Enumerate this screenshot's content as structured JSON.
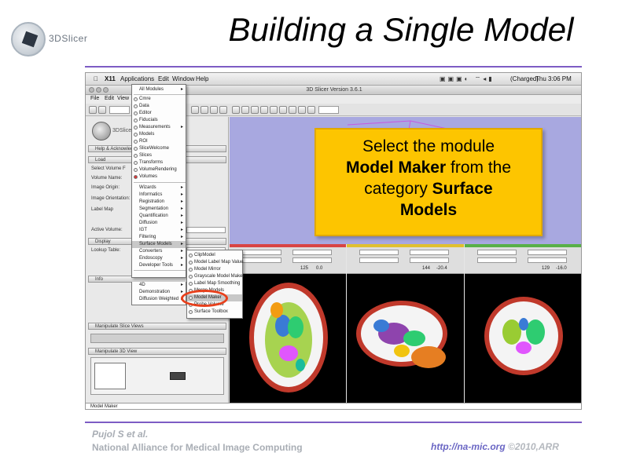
{
  "slide": {
    "logo_text": "3DSlicer",
    "title": "Building a Single Model",
    "footer_author": "Pujol S et al.",
    "footer_org": "National Alliance for Medical Image Computing",
    "footer_url": "http://na-mic.org",
    "footer_copyright": "©2010,ARR"
  },
  "callout": {
    "line1": "Select the module",
    "module_name": "Model Maker",
    "line2_rest": " from the",
    "line3_lead": "category ",
    "category_part1": "Surface",
    "category_part2": "Models"
  },
  "mac_menubar": {
    "app": "X11",
    "items": [
      "Applications",
      "Edit",
      "Window",
      "Help"
    ],
    "battery": "(Charged)",
    "clock": "Thu 3:06 PM"
  },
  "window": {
    "title": "3D Slicer Version 3.6.1",
    "menu": [
      "File",
      "Edit",
      "View",
      "W"
    ]
  },
  "left_panel": {
    "logo_text": "3DSlicer",
    "help_header": "Help & Acknowledge",
    "load_header": "Load",
    "select_volume": "Select Volume F",
    "volume_name": "Volume Name:",
    "image_origin": "Image Origin:",
    "image_orientation": "Image Orientation:",
    "label_map": "Label Map",
    "active_volume": "Active Volume:",
    "display_header": "Display",
    "lookup_table": "Lookup Table:",
    "info_header": "Info",
    "manip_slice": "Manipulate Slice Views",
    "manip_3d": "Manipulate 3D View"
  },
  "menu_categories": [
    {
      "label": "All Modules",
      "sub": true
    },
    {
      "label": "Cmre",
      "sub": false
    },
    {
      "label": "Data",
      "sub": false
    },
    {
      "label": "Editor",
      "sub": false
    },
    {
      "label": "Fiducials",
      "sub": false
    },
    {
      "label": "Measurements",
      "sub": true
    },
    {
      "label": "Models",
      "sub": false
    },
    {
      "label": "ROI",
      "sub": false
    },
    {
      "label": "SliceWelcome",
      "sub": false
    },
    {
      "label": "Slices",
      "sub": false
    },
    {
      "label": "Transforms",
      "sub": false
    },
    {
      "label": "VolumeRendering",
      "sub": false
    },
    {
      "label": "Volumes",
      "sub": false
    },
    {
      "label": "Wizards",
      "sub": true
    },
    {
      "label": "Informatics",
      "sub": true
    },
    {
      "label": "Registration",
      "sub": true
    },
    {
      "label": "Segmentation",
      "sub": true
    },
    {
      "label": "Quantification",
      "sub": true
    },
    {
      "label": "Diffusion",
      "sub": true
    },
    {
      "label": "IGT",
      "sub": true
    },
    {
      "label": "Filtering",
      "sub": true
    },
    {
      "label": "Surface Models",
      "sub": true
    },
    {
      "label": "Converters",
      "sub": true
    },
    {
      "label": "Endoscopy",
      "sub": true
    },
    {
      "label": "Developer Tools",
      "sub": true
    },
    {
      "label": "4D",
      "sub": true
    },
    {
      "label": "Demonstration",
      "sub": true
    },
    {
      "label": "Diffusion Weighted",
      "sub": true
    }
  ],
  "menu_surface_models": [
    "ClipModel",
    "Model Label Map Value",
    "Model Mirror",
    "Grayscale Model Maker",
    "Label Map Smoothing",
    "Merge Models",
    "Model Maker",
    "Probe Volume",
    "Surface Toolbox"
  ],
  "slice_views": [
    {
      "val1": "125",
      "val2": "0.0",
      "color": "#d84444"
    },
    {
      "val1": "144",
      "val2": "-20.4",
      "color": "#e0c030"
    },
    {
      "val1": "129",
      "val2": "-16.0",
      "color": "#58b048"
    }
  ],
  "module_bar": "Model Maker"
}
